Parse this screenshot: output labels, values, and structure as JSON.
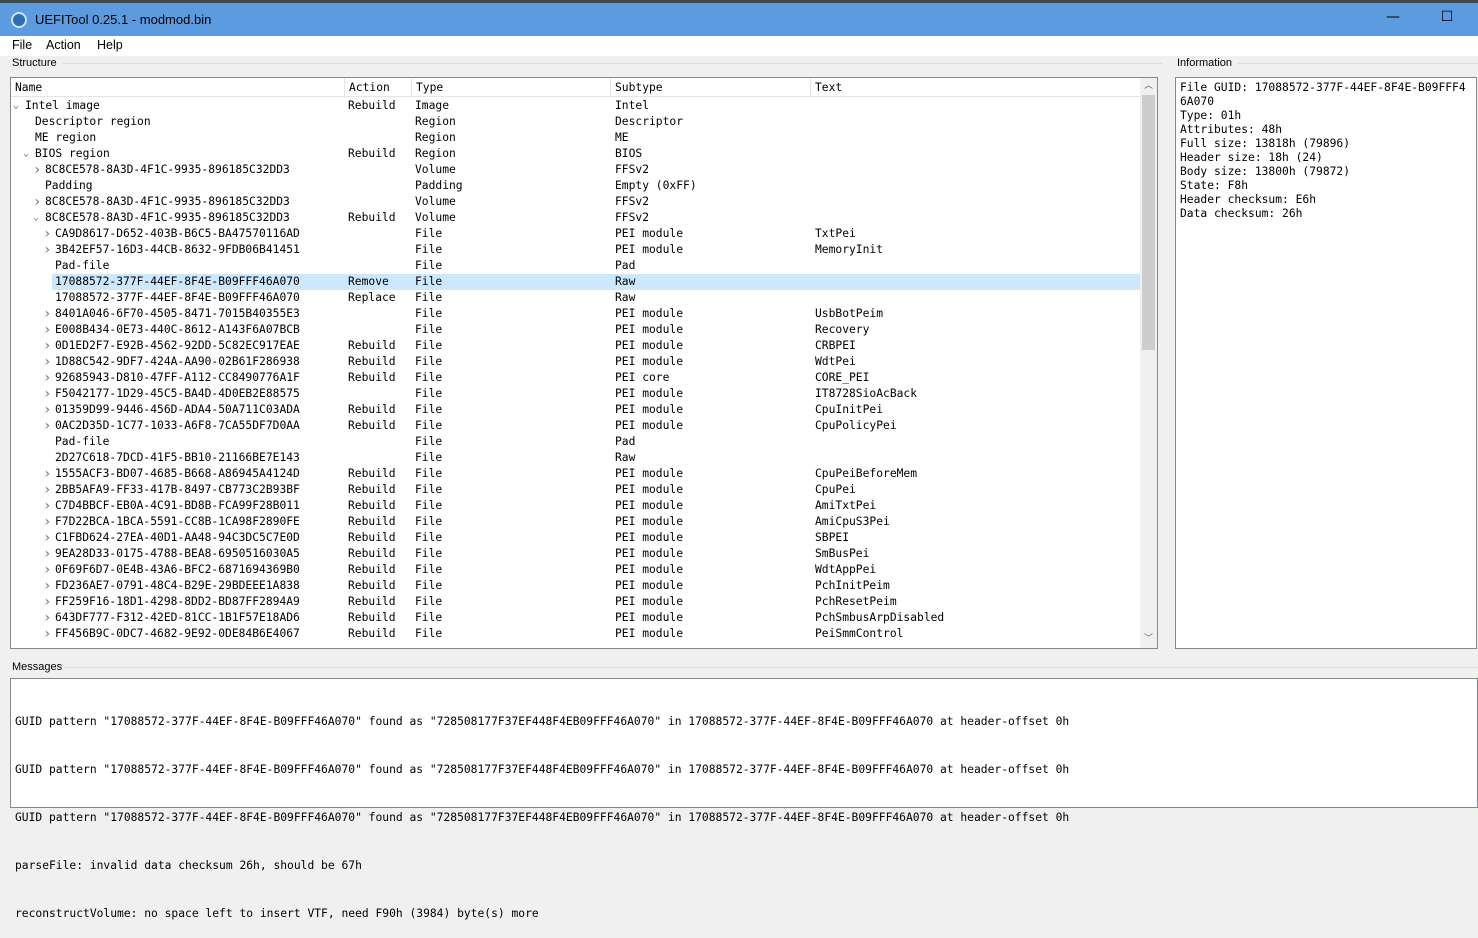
{
  "window": {
    "title": "UEFITool 0.25.1 - modmod.bin",
    "minimize": "—",
    "maximize": "☐"
  },
  "menu": [
    "File",
    "Action",
    "Help"
  ],
  "structure": {
    "label": "Structure",
    "columns": [
      "Name",
      "Action",
      "Type",
      "Subtype",
      "Text"
    ],
    "rows": [
      {
        "level": 0,
        "expander": "open",
        "name": "Intel image",
        "action": "Rebuild",
        "type": "Image",
        "subtype": "Intel",
        "text": ""
      },
      {
        "level": 1,
        "expander": "none",
        "name": "Descriptor region",
        "action": "",
        "type": "Region",
        "subtype": "Descriptor",
        "text": ""
      },
      {
        "level": 1,
        "expander": "none",
        "name": "ME region",
        "action": "",
        "type": "Region",
        "subtype": "ME",
        "text": ""
      },
      {
        "level": 1,
        "expander": "open",
        "name": "BIOS region",
        "action": "Rebuild",
        "type": "Region",
        "subtype": "BIOS",
        "text": ""
      },
      {
        "level": 2,
        "expander": "closed",
        "name": "8C8CE578-8A3D-4F1C-9935-896185C32DD3",
        "action": "",
        "type": "Volume",
        "subtype": "FFSv2",
        "text": ""
      },
      {
        "level": 2,
        "expander": "none",
        "name": "Padding",
        "action": "",
        "type": "Padding",
        "subtype": "Empty (0xFF)",
        "text": ""
      },
      {
        "level": 2,
        "expander": "closed",
        "name": "8C8CE578-8A3D-4F1C-9935-896185C32DD3",
        "action": "",
        "type": "Volume",
        "subtype": "FFSv2",
        "text": ""
      },
      {
        "level": 2,
        "expander": "open",
        "name": "8C8CE578-8A3D-4F1C-9935-896185C32DD3",
        "action": "Rebuild",
        "type": "Volume",
        "subtype": "FFSv2",
        "text": ""
      },
      {
        "level": 3,
        "expander": "closed",
        "name": "CA9D8617-D652-403B-B6C5-BA47570116AD",
        "action": "",
        "type": "File",
        "subtype": "PEI module",
        "text": "TxtPei"
      },
      {
        "level": 3,
        "expander": "closed",
        "name": "3B42EF57-16D3-44CB-8632-9FDB06B41451",
        "action": "",
        "type": "File",
        "subtype": "PEI module",
        "text": "MemoryInit"
      },
      {
        "level": 3,
        "expander": "none",
        "name": "Pad-file",
        "action": "",
        "type": "File",
        "subtype": "Pad",
        "text": ""
      },
      {
        "level": 3,
        "expander": "none",
        "name": "17088572-377F-44EF-8F4E-B09FFF46A070",
        "action": "Remove",
        "type": "File",
        "subtype": "Raw",
        "text": "",
        "selected": true
      },
      {
        "level": 3,
        "expander": "none",
        "name": "17088572-377F-44EF-8F4E-B09FFF46A070",
        "action": "Replace",
        "type": "File",
        "subtype": "Raw",
        "text": ""
      },
      {
        "level": 3,
        "expander": "closed",
        "name": "8401A046-6F70-4505-8471-7015B40355E3",
        "action": "",
        "type": "File",
        "subtype": "PEI module",
        "text": "UsbBotPeim"
      },
      {
        "level": 3,
        "expander": "closed",
        "name": "E008B434-0E73-440C-8612-A143F6A07BCB",
        "action": "",
        "type": "File",
        "subtype": "PEI module",
        "text": "Recovery"
      },
      {
        "level": 3,
        "expander": "closed",
        "name": "0D1ED2F7-E92B-4562-92DD-5C82EC917EAE",
        "action": "Rebuild",
        "type": "File",
        "subtype": "PEI module",
        "text": "CRBPEI"
      },
      {
        "level": 3,
        "expander": "closed",
        "name": "1D88C542-9DF7-424A-AA90-02B61F286938",
        "action": "Rebuild",
        "type": "File",
        "subtype": "PEI module",
        "text": "WdtPei"
      },
      {
        "level": 3,
        "expander": "closed",
        "name": "92685943-D810-47FF-A112-CC8490776A1F",
        "action": "Rebuild",
        "type": "File",
        "subtype": "PEI core",
        "text": "CORE_PEI"
      },
      {
        "level": 3,
        "expander": "closed",
        "name": "F5042177-1D29-45C5-BA4D-4D0EB2E88575",
        "action": "",
        "type": "File",
        "subtype": "PEI module",
        "text": "IT8728SioAcBack"
      },
      {
        "level": 3,
        "expander": "closed",
        "name": "01359D99-9446-456D-ADA4-50A711C03ADA",
        "action": "Rebuild",
        "type": "File",
        "subtype": "PEI module",
        "text": "CpuInitPei"
      },
      {
        "level": 3,
        "expander": "closed",
        "name": "0AC2D35D-1C77-1033-A6F8-7CA55DF7D0AA",
        "action": "Rebuild",
        "type": "File",
        "subtype": "PEI module",
        "text": "CpuPolicyPei"
      },
      {
        "level": 3,
        "expander": "none",
        "name": "Pad-file",
        "action": "",
        "type": "File",
        "subtype": "Pad",
        "text": ""
      },
      {
        "level": 3,
        "expander": "none",
        "name": "2D27C618-7DCD-41F5-BB10-21166BE7E143",
        "action": "",
        "type": "File",
        "subtype": "Raw",
        "text": ""
      },
      {
        "level": 3,
        "expander": "closed",
        "name": "1555ACF3-BD07-4685-B668-A86945A4124D",
        "action": "Rebuild",
        "type": "File",
        "subtype": "PEI module",
        "text": "CpuPeiBeforeMem"
      },
      {
        "level": 3,
        "expander": "closed",
        "name": "2BB5AFA9-FF33-417B-8497-CB773C2B93BF",
        "action": "Rebuild",
        "type": "File",
        "subtype": "PEI module",
        "text": "CpuPei"
      },
      {
        "level": 3,
        "expander": "closed",
        "name": "C7D4BBCF-EB0A-4C91-BD8B-FCA99F28B011",
        "action": "Rebuild",
        "type": "File",
        "subtype": "PEI module",
        "text": "AmiTxtPei"
      },
      {
        "level": 3,
        "expander": "closed",
        "name": "F7D22BCA-1BCA-5591-CC8B-1CA98F2890FE",
        "action": "Rebuild",
        "type": "File",
        "subtype": "PEI module",
        "text": "AmiCpuS3Pei"
      },
      {
        "level": 3,
        "expander": "closed",
        "name": "C1FBD624-27EA-40D1-AA48-94C3DC5C7E0D",
        "action": "Rebuild",
        "type": "File",
        "subtype": "PEI module",
        "text": "SBPEI"
      },
      {
        "level": 3,
        "expander": "closed",
        "name": "9EA28D33-0175-4788-BEA8-6950516030A5",
        "action": "Rebuild",
        "type": "File",
        "subtype": "PEI module",
        "text": "SmBusPei"
      },
      {
        "level": 3,
        "expander": "closed",
        "name": "0F69F6D7-0E4B-43A6-BFC2-6871694369B0",
        "action": "Rebuild",
        "type": "File",
        "subtype": "PEI module",
        "text": "WdtAppPei"
      },
      {
        "level": 3,
        "expander": "closed",
        "name": "FD236AE7-0791-48C4-B29E-29BDEEE1A838",
        "action": "Rebuild",
        "type": "File",
        "subtype": "PEI module",
        "text": "PchInitPeim"
      },
      {
        "level": 3,
        "expander": "closed",
        "name": "FF259F16-18D1-4298-8DD2-BD87FF2894A9",
        "action": "Rebuild",
        "type": "File",
        "subtype": "PEI module",
        "text": "PchResetPeim"
      },
      {
        "level": 3,
        "expander": "closed",
        "name": "643DF777-F312-42ED-81CC-1B1F57E18AD6",
        "action": "Rebuild",
        "type": "File",
        "subtype": "PEI module",
        "text": "PchSmbusArpDisabled"
      },
      {
        "level": 3,
        "expander": "closed",
        "name": "FF456B9C-0DC7-4682-9E92-0DE84B6E4067",
        "action": "Rebuild",
        "type": "File",
        "subtype": "PEI module",
        "text": "PeiSmmControl"
      }
    ]
  },
  "information": {
    "label": "Information",
    "text": "File GUID: 17088572-377F-44EF-8F4E-B09FFF46A070\nType: 01h\nAttributes: 48h\nFull size: 13818h (79896)\nHeader size: 18h (24)\nBody size: 13800h (79872)\nState: F8h\nHeader checksum: E6h\nData checksum: 26h"
  },
  "messages": {
    "label": "Messages",
    "lines": [
      "GUID pattern \"17088572-377F-44EF-8F4E-B09FFF46A070\" found as \"728508177F37EF448F4EB09FFF46A070\" in 17088572-377F-44EF-8F4E-B09FFF46A070 at header-offset 0h",
      "GUID pattern \"17088572-377F-44EF-8F4E-B09FFF46A070\" found as \"728508177F37EF448F4EB09FFF46A070\" in 17088572-377F-44EF-8F4E-B09FFF46A070 at header-offset 0h",
      "GUID pattern \"17088572-377F-44EF-8F4E-B09FFF46A070\" found as \"728508177F37EF448F4EB09FFF46A070\" in 17088572-377F-44EF-8F4E-B09FFF46A070 at header-offset 0h",
      "parseFile: invalid data checksum 26h, should be 67h",
      "reconstructVolume: no space left to insert VTF, need F90h (3984) byte(s) more"
    ]
  },
  "colors": {
    "titlebar": "#5d9be0",
    "selection": "#cce8ff"
  }
}
